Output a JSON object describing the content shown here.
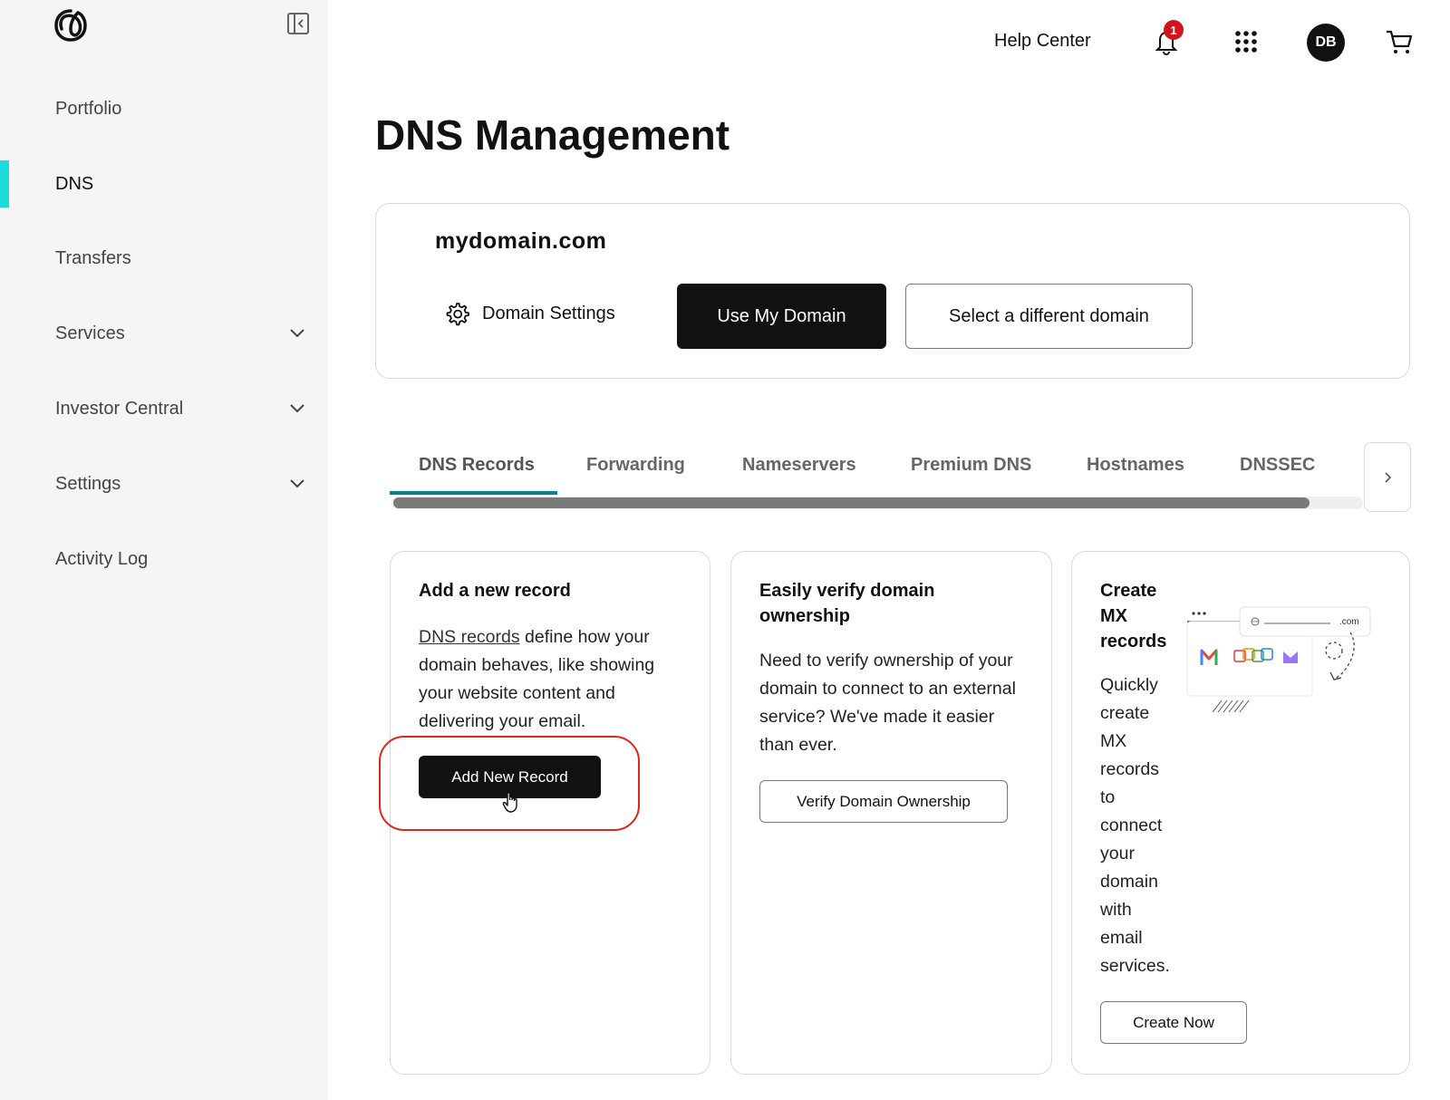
{
  "sidebar": {
    "items": [
      {
        "label": "Portfolio"
      },
      {
        "label": "DNS"
      },
      {
        "label": "Transfers"
      },
      {
        "label": "Services"
      },
      {
        "label": "Investor Central"
      },
      {
        "label": "Settings"
      },
      {
        "label": "Activity Log"
      }
    ],
    "active": "DNS",
    "accent_color": "#1bdbdb"
  },
  "header": {
    "help_label": "Help Center",
    "notification_count": "1",
    "avatar_initials": "DB"
  },
  "page_title": "DNS Management",
  "domain": {
    "name": "mydomain.com",
    "settings_label": "Domain Settings",
    "use_label": "Use My Domain",
    "select_label": "Select a different domain"
  },
  "tabs": [
    {
      "label": "DNS Records"
    },
    {
      "label": "Forwarding"
    },
    {
      "label": "Nameservers"
    },
    {
      "label": "Premium DNS"
    },
    {
      "label": "Hostnames"
    },
    {
      "label": "DNSSEC"
    }
  ],
  "cards": {
    "add_record": {
      "title": "Add a new record",
      "link_text": "DNS records",
      "text_line1": " define how your",
      "text_rest": "domain behaves, like showing your website content and delivering your email.",
      "button": "Add New Record"
    },
    "verify": {
      "title": "Easily verify domain ownership",
      "text": "Need to verify ownership of your domain to connect to an external service? We've made it easier than ever.",
      "button": "Verify Domain Ownership"
    },
    "mx": {
      "title": "Create MX records",
      "text": "Quickly create MX records to connect your domain with email services.",
      "button": "Create Now",
      "illus_domain_text": ".com"
    }
  }
}
